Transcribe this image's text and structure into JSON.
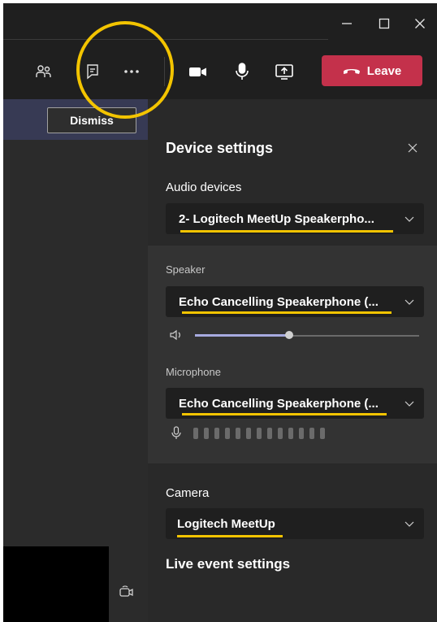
{
  "toolbar": {
    "icons": [
      "participants-icon",
      "chat-icon",
      "more-options-icon",
      "camera-icon",
      "microphone-icon",
      "share-screen-icon"
    ],
    "leave_label": "Leave",
    "leave_color": "#c4314b"
  },
  "banner": {
    "dismiss_label": "Dismiss"
  },
  "panel": {
    "title": "Device settings",
    "audio_devices_label": "Audio devices",
    "audio_device_value": "2- Logitech MeetUp Speakerpho...",
    "speaker_label": "Speaker",
    "speaker_value": "Echo Cancelling Speakerphone (...",
    "speaker_volume_percent": 42,
    "microphone_label": "Microphone",
    "microphone_value": "Echo Cancelling Speakerphone (...",
    "mic_level_bars": 13,
    "camera_label": "Camera",
    "camera_value": "Logitech MeetUp",
    "live_event_title": "Live event settings"
  },
  "colors": {
    "highlight": "#f3c400",
    "accent_slider": "#a7abe0",
    "panel_bg": "#292929",
    "banner_bg": "#373a54"
  }
}
